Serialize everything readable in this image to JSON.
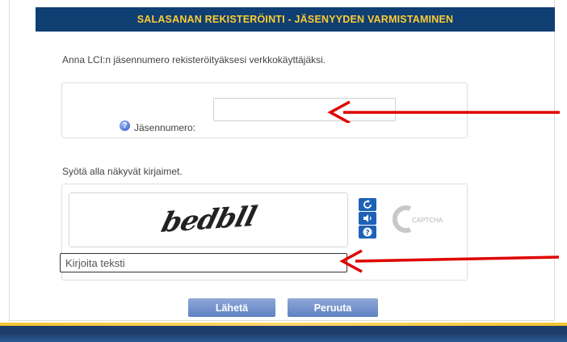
{
  "header": {
    "title": "SALASANAN REKISTERÖINTI - JÄSENYYDEN VARMISTAMINEN"
  },
  "member": {
    "instruction": "Anna LCI:n jäsennumero rekisteröityäksesi verkkokäyttäjäksi.",
    "label": "Jäsennumero:",
    "value": ""
  },
  "captcha": {
    "instruction": "Syötä alla näkyvät kirjaimet.",
    "challenge_text": "bedbll",
    "input_placeholder": "Kirjoita teksti",
    "logo_text": "CAPTCHA"
  },
  "buttons": {
    "send": "Lähetä",
    "cancel": "Peruuta"
  },
  "colors": {
    "title_bg": "#0f3f73",
    "title_text": "#ffcc33",
    "button": "#6d8ecb",
    "arrow": "#e00000"
  },
  "icons": {
    "help": "help-icon",
    "refresh": "refresh-icon",
    "audio": "audio-icon",
    "captcha_help": "question-icon",
    "arrow": "red-arrow-icon"
  }
}
